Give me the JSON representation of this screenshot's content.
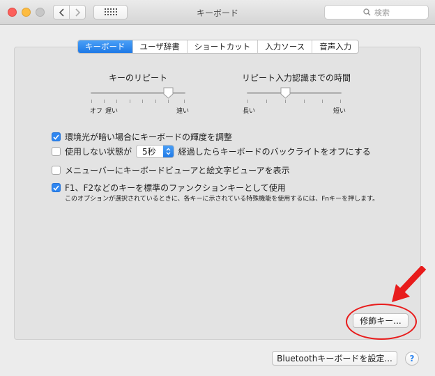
{
  "window": {
    "title": "キーボード",
    "search_placeholder": "検索"
  },
  "tabs": [
    {
      "label": "キーボード",
      "active": true
    },
    {
      "label": "ユーザ辞書",
      "active": false
    },
    {
      "label": "ショートカット",
      "active": false
    },
    {
      "label": "入力ソース",
      "active": false
    },
    {
      "label": "音声入力",
      "active": false
    }
  ],
  "key_repeat": {
    "title": "キーのリピート",
    "label_off": "オフ",
    "label_slow": "遅い",
    "label_fast": "速い"
  },
  "repeat_delay": {
    "title": "リピート入力認識までの時間",
    "label_long": "長い",
    "label_short": "短い"
  },
  "options": {
    "auto_brightness": {
      "label": "環境光が暗い場合にキーボードの輝度を調整",
      "checked": true
    },
    "backlight_off": {
      "label_before": "使用しない状態が",
      "stepper_value": "5秒",
      "label_after": "経過したらキーボードのバックライトをオフにする",
      "checked": false
    },
    "show_viewer": {
      "label": "メニューバーにキーボードビューアと絵文字ビューアを表示",
      "checked": false
    },
    "fn_keys": {
      "label": "F1、F2などのキーを標準のファンクションキーとして使用",
      "checked": true
    },
    "fn_note": "このオプションが選択されているときに、各キーに示されている特殊機能を使用するには、Fnキーを押します。"
  },
  "buttons": {
    "modifier_keys": "修飾キー...",
    "bluetooth": "Bluetoothキーボードを設定...",
    "help": "?"
  },
  "colors": {
    "accent": "#2f86f0",
    "annotation": "#e81c1c"
  }
}
